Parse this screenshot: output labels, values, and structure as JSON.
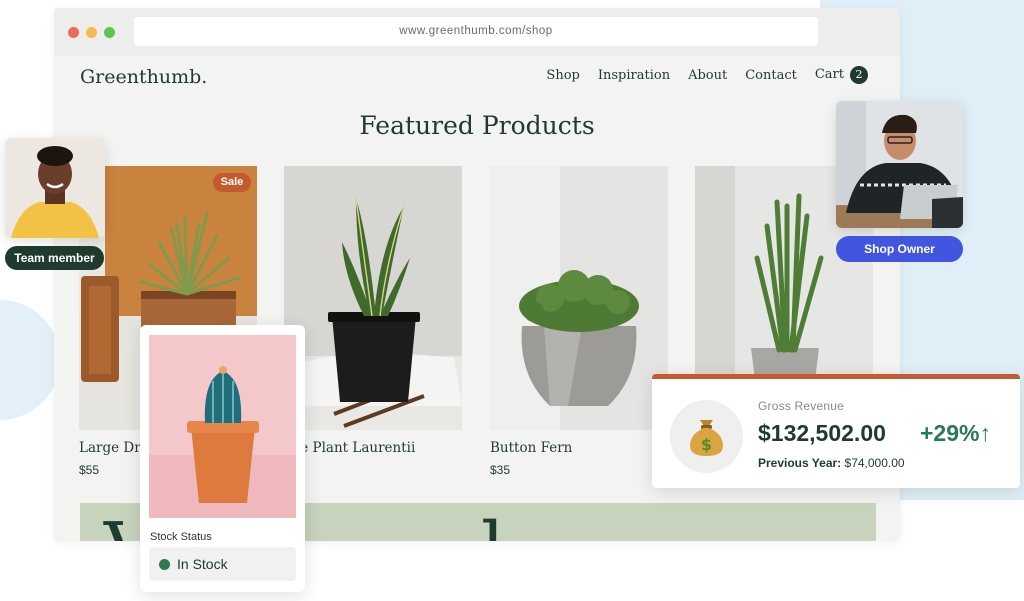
{
  "browser": {
    "url": "www.greenthumb.com/shop"
  },
  "site": {
    "brand": "Greenthumb.",
    "nav": [
      "Shop",
      "Inspiration",
      "About",
      "Contact",
      "Cart"
    ],
    "cart_count": "2",
    "heading": "Featured Products"
  },
  "products": [
    {
      "name": "Large Dra",
      "price": "$55",
      "badge": "Sale"
    },
    {
      "name": "ake Plant Laurentii",
      "price": ""
    },
    {
      "name": "Button Fern",
      "price": "$35"
    },
    {
      "name": "",
      "price": ""
    }
  ],
  "banner_text": "V l",
  "team_member": {
    "label": "Team member"
  },
  "shop_owner": {
    "label": "Shop Owner"
  },
  "stock": {
    "label": "Stock Status",
    "value": "In Stock"
  },
  "revenue": {
    "label": "Gross Revenue",
    "value": "$132,502.00",
    "change": "+29%↑",
    "previous_label": "Previous Year:",
    "previous_value": "$74,000.00",
    "icon": "money-bag-icon"
  },
  "colors": {
    "dark_green": "#1f3a2f",
    "sale_orange": "#c55a31",
    "owner_blue": "#4255e0",
    "positive_green": "#2a7a52"
  }
}
